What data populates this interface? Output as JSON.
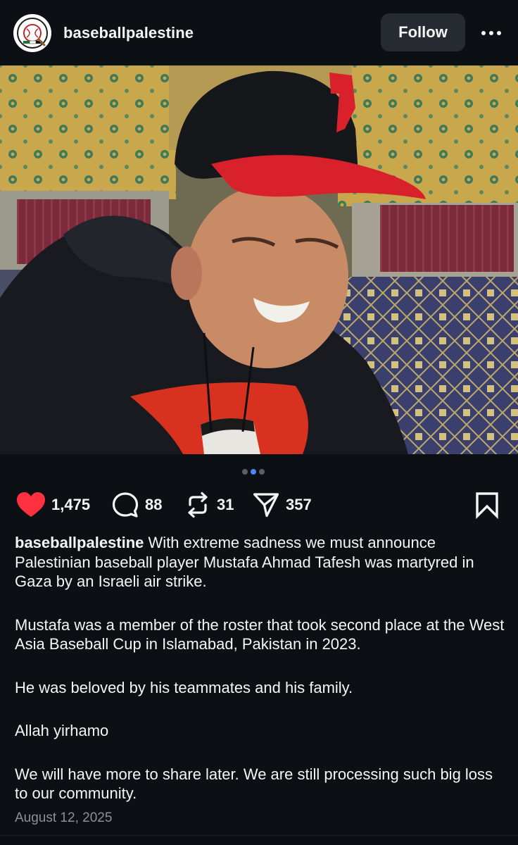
{
  "post": {
    "username": "baseballpalestine",
    "follow_label": "Follow",
    "more_icon": "more-horizontal-icon"
  },
  "carousel": {
    "total": 3,
    "active_index": 1
  },
  "stats": {
    "likes": "1,475",
    "comments": "88",
    "reposts": "31",
    "shares": "357",
    "liked": true,
    "like_color": "#ff3040"
  },
  "caption": {
    "username": "baseballpalestine",
    "paragraph_1": "With extreme sadness we must announce Palestinian baseball player Mustafa Ahmad Tafesh was martyred in Gaza by an Israeli air strike.",
    "paragraph_2": "Mustafa was a member of the roster that took second place at the West Asia Baseball Cup in Islamabad, Pakistan in 2023.",
    "paragraph_3": "He was beloved by his teammates and his family.",
    "paragraph_4": "Allah yirhamo",
    "paragraph_5": "We will have more to share later. We are still processing such big loss to our community."
  },
  "date": "August 12, 2025"
}
